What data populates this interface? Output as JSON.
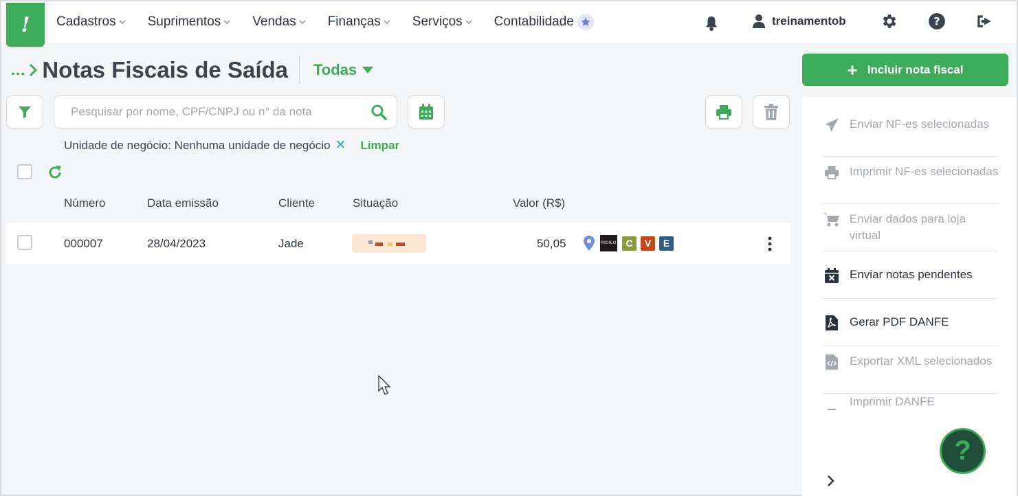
{
  "nav": {
    "items": [
      {
        "label": "Cadastros",
        "chevron": true
      },
      {
        "label": "Suprimentos",
        "chevron": true
      },
      {
        "label": "Vendas",
        "chevron": true
      },
      {
        "label": "Finanças",
        "chevron": true
      },
      {
        "label": "Serviços",
        "chevron": true
      },
      {
        "label": "Contabilidade",
        "chevron": false,
        "badge": "star-icon"
      }
    ],
    "user": "treinamentob"
  },
  "breadcrumb": {
    "dots": "...",
    "title": "Notas Fiscais de Saída",
    "filter": "Todas"
  },
  "actions": {
    "include_label": "Incluir nota fiscal"
  },
  "search": {
    "placeholder": "Pesquisar por nome, CPF/CNPJ ou n° da nota",
    "value": ""
  },
  "filters": {
    "chip": "Unidade de negócio: Nenhuma unidade de negócio",
    "remove": "✕",
    "clear": "Limpar"
  },
  "table": {
    "headers": [
      "Número",
      "Data emissão",
      "Cliente",
      "Situação",
      "Valor (R$)"
    ],
    "rows": [
      {
        "numero": "000007",
        "data": "28/04/2023",
        "cliente": "Jade",
        "valor": "50,05",
        "badges": [
          {
            "type": "marker",
            "icon": "map-pin-icon",
            "color": "#6f8fd6"
          },
          {
            "type": "logo",
            "text": "RCHLO",
            "color": "#1e1a1c"
          },
          {
            "type": "letter",
            "text": "C",
            "color": "#8b9a3c"
          },
          {
            "type": "letter",
            "text": "V",
            "color": "#c4491c"
          },
          {
            "type": "letter",
            "text": "E",
            "color": "#2f5d86"
          }
        ]
      }
    ]
  },
  "side_menu": {
    "items": [
      {
        "label": "Enviar NF-es selecionadas",
        "icon": "paper-plane-icon",
        "enabled": false
      },
      {
        "label": "Imprimir NF-es selecionadas",
        "icon": "printer-icon",
        "enabled": false
      },
      {
        "label": "Enviar dados para loja virtual",
        "icon": "cart-icon",
        "enabled": false
      },
      {
        "label": "Enviar notas pendentes",
        "icon": "calendar-x-icon",
        "enabled": true
      },
      {
        "label": "Gerar PDF DANFE",
        "icon": "pdf-file-icon",
        "enabled": true
      },
      {
        "label": "Exportar XML selecionados",
        "icon": "code-file-icon",
        "enabled": false
      },
      {
        "label": "Imprimir DANFE",
        "icon": "printer-icon",
        "enabled": false
      }
    ]
  },
  "help_fab": "?",
  "colors": {
    "brand_green": "#3eab5a",
    "text_dark": "#2b3340",
    "text_muted": "#a3a8b0",
    "accent_teal": "#3a9fb0"
  }
}
